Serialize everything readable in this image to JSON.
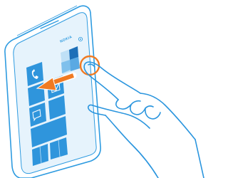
{
  "brand": {
    "logo_text": "NOKIA"
  },
  "colors": {
    "outline": "#2e9be0",
    "phone_body": "#ffffff",
    "screen_frame": "#e6f3fc",
    "tile_blue": "#2f95dc",
    "tile_light": "#7fc0ec",
    "tile_pale": "#bfe0f6",
    "tile_dark": "#1d6fb8",
    "arrow": "#f07a22",
    "touch_ring": "#f07a22",
    "hand_line": "#2a95de"
  },
  "screen": {
    "tiles_visible": [
      "phone-tile",
      "mail-tile",
      "messaging-tile",
      "blank-tiles",
      "mosaic-tile"
    ]
  },
  "gesture": {
    "type": "swipe-left",
    "indicator": "left-arrow-icon",
    "start_marker": "touch-point-ring"
  }
}
